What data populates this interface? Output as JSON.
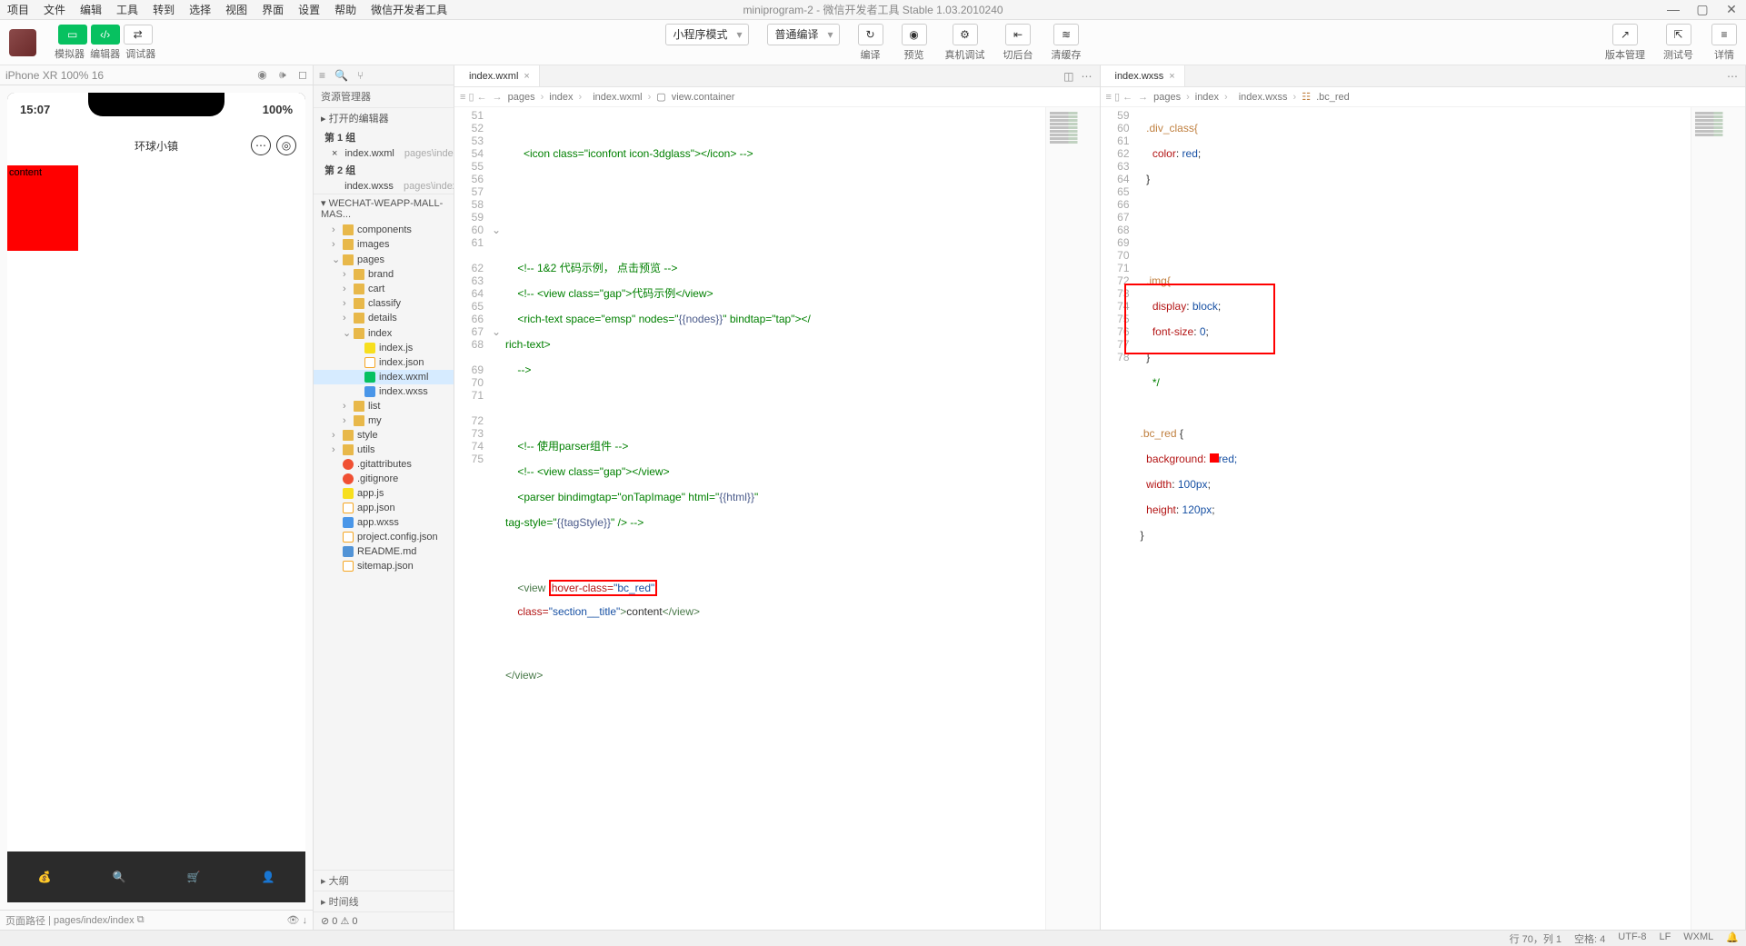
{
  "menu": {
    "items": [
      "项目",
      "文件",
      "编辑",
      "工具",
      "转到",
      "选择",
      "视图",
      "界面",
      "设置",
      "帮助",
      "微信开发者工具"
    ],
    "title": "miniprogram-2 - 微信开发者工具 Stable 1.03.2010240"
  },
  "toolbar": {
    "modeLabels": [
      "模拟器",
      "编辑器",
      "调试器"
    ],
    "dropdown1": "小程序模式",
    "dropdown2": "普通编译",
    "actions": [
      {
        "icon": "↻",
        "label": "编译"
      },
      {
        "icon": "◉",
        "label": "预览"
      },
      {
        "icon": "⚙",
        "label": "真机调试"
      },
      {
        "icon": "⇤",
        "label": "切后台"
      },
      {
        "icon": "≋",
        "label": "清缓存"
      }
    ],
    "right": [
      {
        "icon": "↗",
        "label": "版本管理"
      },
      {
        "icon": "⇱",
        "label": "测试号"
      },
      {
        "icon": "≡",
        "label": "详情"
      }
    ]
  },
  "sim": {
    "device": "iPhone XR 100% 16",
    "time": "15:07",
    "battery": "100%",
    "appTitle": "环球小镇",
    "boxText": "content",
    "footerPath": "页面路径",
    "footerRoute": "pages/index/index"
  },
  "tree": {
    "title": "资源管理器",
    "openEditorsTitle": "打开的编辑器",
    "group1": "第 1 组",
    "group2": "第 2 组",
    "openTabs": [
      {
        "name": "index.wxml",
        "hint": "pages\\index"
      },
      {
        "name": "index.wxss",
        "hint": "pages\\index"
      }
    ],
    "project": "WECHAT-WEAPP-MALL-MAS...",
    "nodes": [
      {
        "name": "components",
        "type": "folder",
        "exp": "›",
        "ind": 1
      },
      {
        "name": "images",
        "type": "folder",
        "exp": "›",
        "ind": 1
      },
      {
        "name": "pages",
        "type": "folder",
        "exp": "⌄",
        "ind": 1
      },
      {
        "name": "brand",
        "type": "folder",
        "exp": "›",
        "ind": 2
      },
      {
        "name": "cart",
        "type": "folder",
        "exp": "›",
        "ind": 2
      },
      {
        "name": "classify",
        "type": "folder",
        "exp": "›",
        "ind": 2
      },
      {
        "name": "details",
        "type": "folder",
        "exp": "›",
        "ind": 2
      },
      {
        "name": "index",
        "type": "folder",
        "exp": "⌄",
        "ind": 2
      },
      {
        "name": "index.js",
        "type": "js",
        "ind": 3
      },
      {
        "name": "index.json",
        "type": "json",
        "ind": 3
      },
      {
        "name": "index.wxml",
        "type": "wxml",
        "ind": 3,
        "sel": true
      },
      {
        "name": "index.wxss",
        "type": "wxss",
        "ind": 3
      },
      {
        "name": "list",
        "type": "folder",
        "exp": "›",
        "ind": 2
      },
      {
        "name": "my",
        "type": "folder",
        "exp": "›",
        "ind": 2
      },
      {
        "name": "style",
        "type": "folder",
        "exp": "›",
        "ind": 1
      },
      {
        "name": "utils",
        "type": "folder",
        "exp": "›",
        "ind": 1
      },
      {
        "name": ".gitattributes",
        "type": "git",
        "ind": 1
      },
      {
        "name": ".gitignore",
        "type": "git",
        "ind": 1
      },
      {
        "name": "app.js",
        "type": "js",
        "ind": 1
      },
      {
        "name": "app.json",
        "type": "json",
        "ind": 1
      },
      {
        "name": "app.wxss",
        "type": "wxss",
        "ind": 1
      },
      {
        "name": "project.config.json",
        "type": "json",
        "ind": 1
      },
      {
        "name": "README.md",
        "type": "md",
        "ind": 1
      },
      {
        "name": "sitemap.json",
        "type": "json",
        "ind": 1
      }
    ],
    "outline": "大纲",
    "timeline": "时间线",
    "err": "⊘ 0 ⚠ 0"
  },
  "editor1": {
    "tabName": "index.wxml",
    "crumb": [
      "pages",
      "index",
      "index.wxml",
      "view.container"
    ],
    "lines": [
      51,
      52,
      53,
      54,
      55,
      56,
      57,
      58,
      59,
      60,
      61,
      "",
      62,
      63,
      64,
      65,
      66,
      67,
      68,
      "",
      69,
      70,
      71,
      "",
      72,
      73,
      74,
      75
    ]
  },
  "code1": {
    "l52": "      <icon class=\"iconfont icon-3dglass\"></icon> -->",
    "l59": "    <!-- 1&2 代码示例， 点击预览 -->",
    "l60": "    <!-- <view class=\"gap\">代码示例</view>",
    "l61a": "    <rich-text space=\"emsp\" nodes=\"",
    "l61b": "{{nodes}}",
    "l61c": "\" bindtap=\"tap\"></",
    "l61d": "rich-text>",
    "l62": "    -->",
    "l66": "    <!-- 使用parser组件 -->",
    "l67": "    <!-- <view class=\"gap\"></view>",
    "l68a": "    <parser bindimgtap=\"onTapImage\" html=\"",
    "l68b": "{{html}}",
    "l68c": "\"",
    "l68d": "tag-style=\"",
    "l68e": "{{tagStyle}}",
    "l68f": "\" /> -->",
    "l71a": "    <view ",
    "l71b": "hover-class=\"bc_red\"",
    "l71c": "    class=",
    "l71d": "\"section__title\"",
    "l71e": ">content</",
    "l71f": "view",
    "l71g": ">",
    "l74": "</view>"
  },
  "editor2": {
    "tabName": "index.wxss",
    "crumb": [
      "pages",
      "index",
      "index.wxss",
      ".bc_red"
    ],
    "lines": [
      59,
      60,
      61,
      62,
      63,
      64,
      65,
      66,
      67,
      68,
      69,
      70,
      71,
      72,
      73,
      74,
      75,
      76,
      77,
      78
    ]
  },
  "code2": {
    "l59": "  .div_class{",
    "l60": "    color: red;",
    "l61": "  }",
    "l67": "  .img{",
    "l68": "    display: block;",
    "l69": "    font-size: 0;",
    "l70": "  }",
    "l71": "    */",
    "l73": ".bc_red ",
    "l74a": "  background: ",
    "l74b": "red;",
    "l75": "  width: 100px;",
    "l76": "  height: 120px;"
  },
  "status": {
    "pos": "行 70，列 1",
    "spaces": "空格: 4",
    "enc": "UTF-8",
    "eol": "LF",
    "lang": "WXML",
    "bell": "🔔"
  }
}
